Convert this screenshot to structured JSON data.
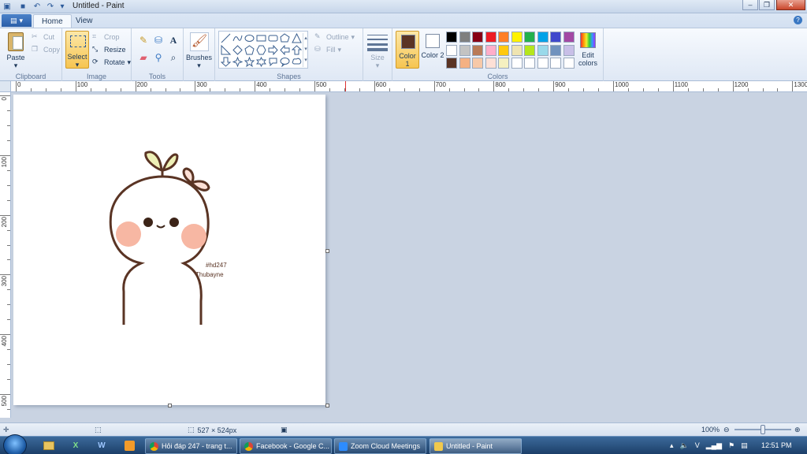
{
  "window": {
    "title": "Untitled - Paint"
  },
  "tabs": {
    "home": "Home",
    "view": "View"
  },
  "ribbon": {
    "clipboard": {
      "label": "Clipboard",
      "paste": "Paste",
      "cut": "Cut",
      "copy": "Copy"
    },
    "image": {
      "label": "Image",
      "select": "Select",
      "crop": "Crop",
      "resize": "Resize",
      "rotate": "Rotate"
    },
    "tools": {
      "label": "Tools"
    },
    "brushes": {
      "label": "Brushes"
    },
    "shapes": {
      "label": "Shapes",
      "outline": "Outline",
      "fill": "Fill"
    },
    "size": {
      "label": "Size"
    },
    "colors": {
      "label": "Colors",
      "color1": "Color 1",
      "color2": "Color 2",
      "edit": "Edit colors",
      "color1_value": "#5a3424",
      "color2_value": "#ffffff",
      "palette": [
        "#000000",
        "#7f7f7f",
        "#880015",
        "#ed1c24",
        "#ff7f27",
        "#fff200",
        "#22b14c",
        "#00a2e8",
        "#3f48cc",
        "#a349a4",
        "#ffffff",
        "#c3c3c3",
        "#b97a57",
        "#ffaec9",
        "#ffc90e",
        "#efe4b0",
        "#b5e61d",
        "#99d9ea",
        "#7092be",
        "#c8bfe7",
        "#5a3424",
        "#f4b183",
        "#f7c9a8",
        "#fde0d6",
        "#f5f0c0",
        "#ffffff",
        "#ffffff",
        "#ffffff",
        "#ffffff",
        "#ffffff"
      ]
    }
  },
  "ruler": {
    "h_labels": [
      "0",
      "100",
      "200",
      "300",
      "400",
      "500",
      "600",
      "700",
      "800",
      "900",
      "1000",
      "1100",
      "1200",
      "1300"
    ],
    "v_labels": [
      "0",
      "100",
      "200",
      "300",
      "400",
      "500"
    ]
  },
  "canvas": {
    "tag": "#hd247",
    "signature": "Thubayne"
  },
  "status": {
    "size": "527 × 524px",
    "zoom": "100%"
  },
  "taskbar": {
    "pinned": [
      "X",
      "W"
    ],
    "tasks": [
      {
        "label": "Hỏi đáp 247 - trang t...",
        "color": "#e8a33d"
      },
      {
        "label": "Facebook - Google C...",
        "color": "#e8a33d"
      },
      {
        "label": "Zoom Cloud Meetings",
        "color": "#2d8cff"
      },
      {
        "label": "Untitled - Paint",
        "color": "#f2c94c"
      }
    ],
    "clock": "12:51 PM"
  }
}
